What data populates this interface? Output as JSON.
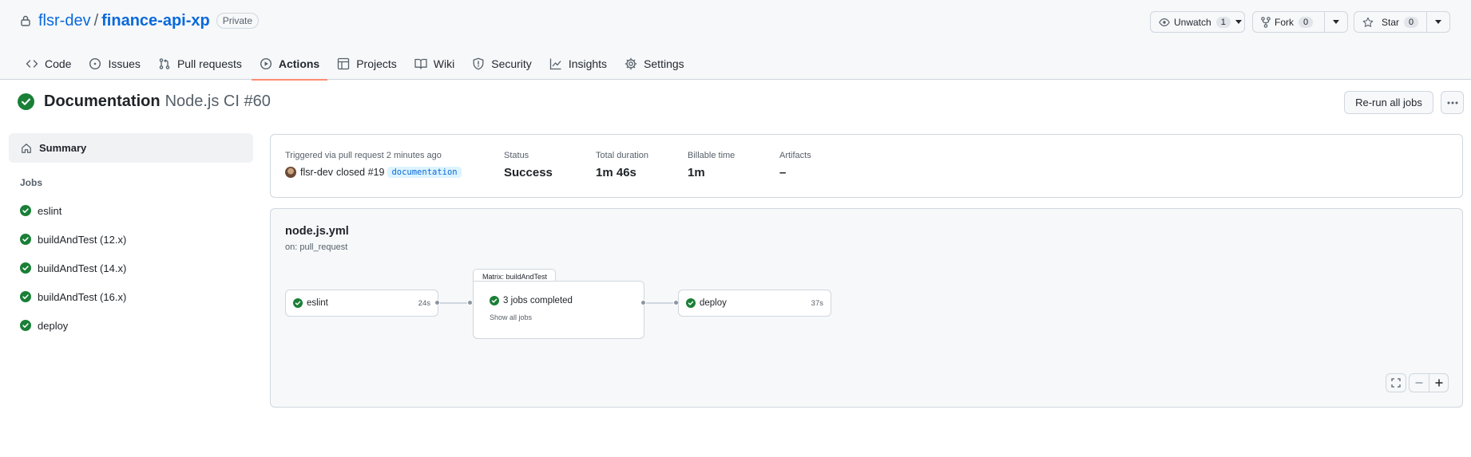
{
  "repo": {
    "owner": "flsr-dev",
    "separator": "/",
    "name": "finance-api-xp",
    "visibility": "Private"
  },
  "header_buttons": {
    "watch": {
      "label": "Unwatch",
      "count": "1"
    },
    "fork": {
      "label": "Fork",
      "count": "0"
    },
    "star": {
      "label": "Star",
      "count": "0"
    }
  },
  "tabs": [
    {
      "label": "Code",
      "icon": "code-icon"
    },
    {
      "label": "Issues",
      "icon": "issue-icon"
    },
    {
      "label": "Pull requests",
      "icon": "pull-request-icon"
    },
    {
      "label": "Actions",
      "icon": "play-icon",
      "active": true
    },
    {
      "label": "Projects",
      "icon": "table-icon"
    },
    {
      "label": "Wiki",
      "icon": "book-icon"
    },
    {
      "label": "Security",
      "icon": "shield-icon"
    },
    {
      "label": "Insights",
      "icon": "graph-icon"
    },
    {
      "label": "Settings",
      "icon": "gear-icon"
    }
  ],
  "run": {
    "workflow_name": "Documentation",
    "ci_label": "Node.js CI #60",
    "rerun_label": "Re-run all jobs"
  },
  "sidebar": {
    "summary_label": "Summary",
    "jobs_heading": "Jobs",
    "jobs": [
      {
        "label": "eslint"
      },
      {
        "label": "buildAndTest (12.x)"
      },
      {
        "label": "buildAndTest (14.x)"
      },
      {
        "label": "buildAndTest (16.x)"
      },
      {
        "label": "deploy"
      }
    ]
  },
  "summary": {
    "trigger_label": "Triggered via pull request 2 minutes ago",
    "actor": "flsr-dev",
    "action_text": "closed #19",
    "pr_label": "documentation",
    "status_label": "Status",
    "status_value": "Success",
    "duration_label": "Total duration",
    "duration_value": "1m 46s",
    "billable_label": "Billable time",
    "billable_value": "1m",
    "artifacts_label": "Artifacts",
    "artifacts_value": "–"
  },
  "graph": {
    "file": "node.js.yml",
    "on": "on: pull_request",
    "eslint": {
      "label": "eslint",
      "duration": "24s"
    },
    "matrix": {
      "title": "Matrix: buildAndTest",
      "label": "3 jobs completed",
      "show_all": "Show all jobs"
    },
    "deploy": {
      "label": "deploy",
      "duration": "37s"
    }
  },
  "colors": {
    "success": "#1a7f37",
    "link": "#0969da",
    "active_tab_underline": "#fd8c73"
  }
}
